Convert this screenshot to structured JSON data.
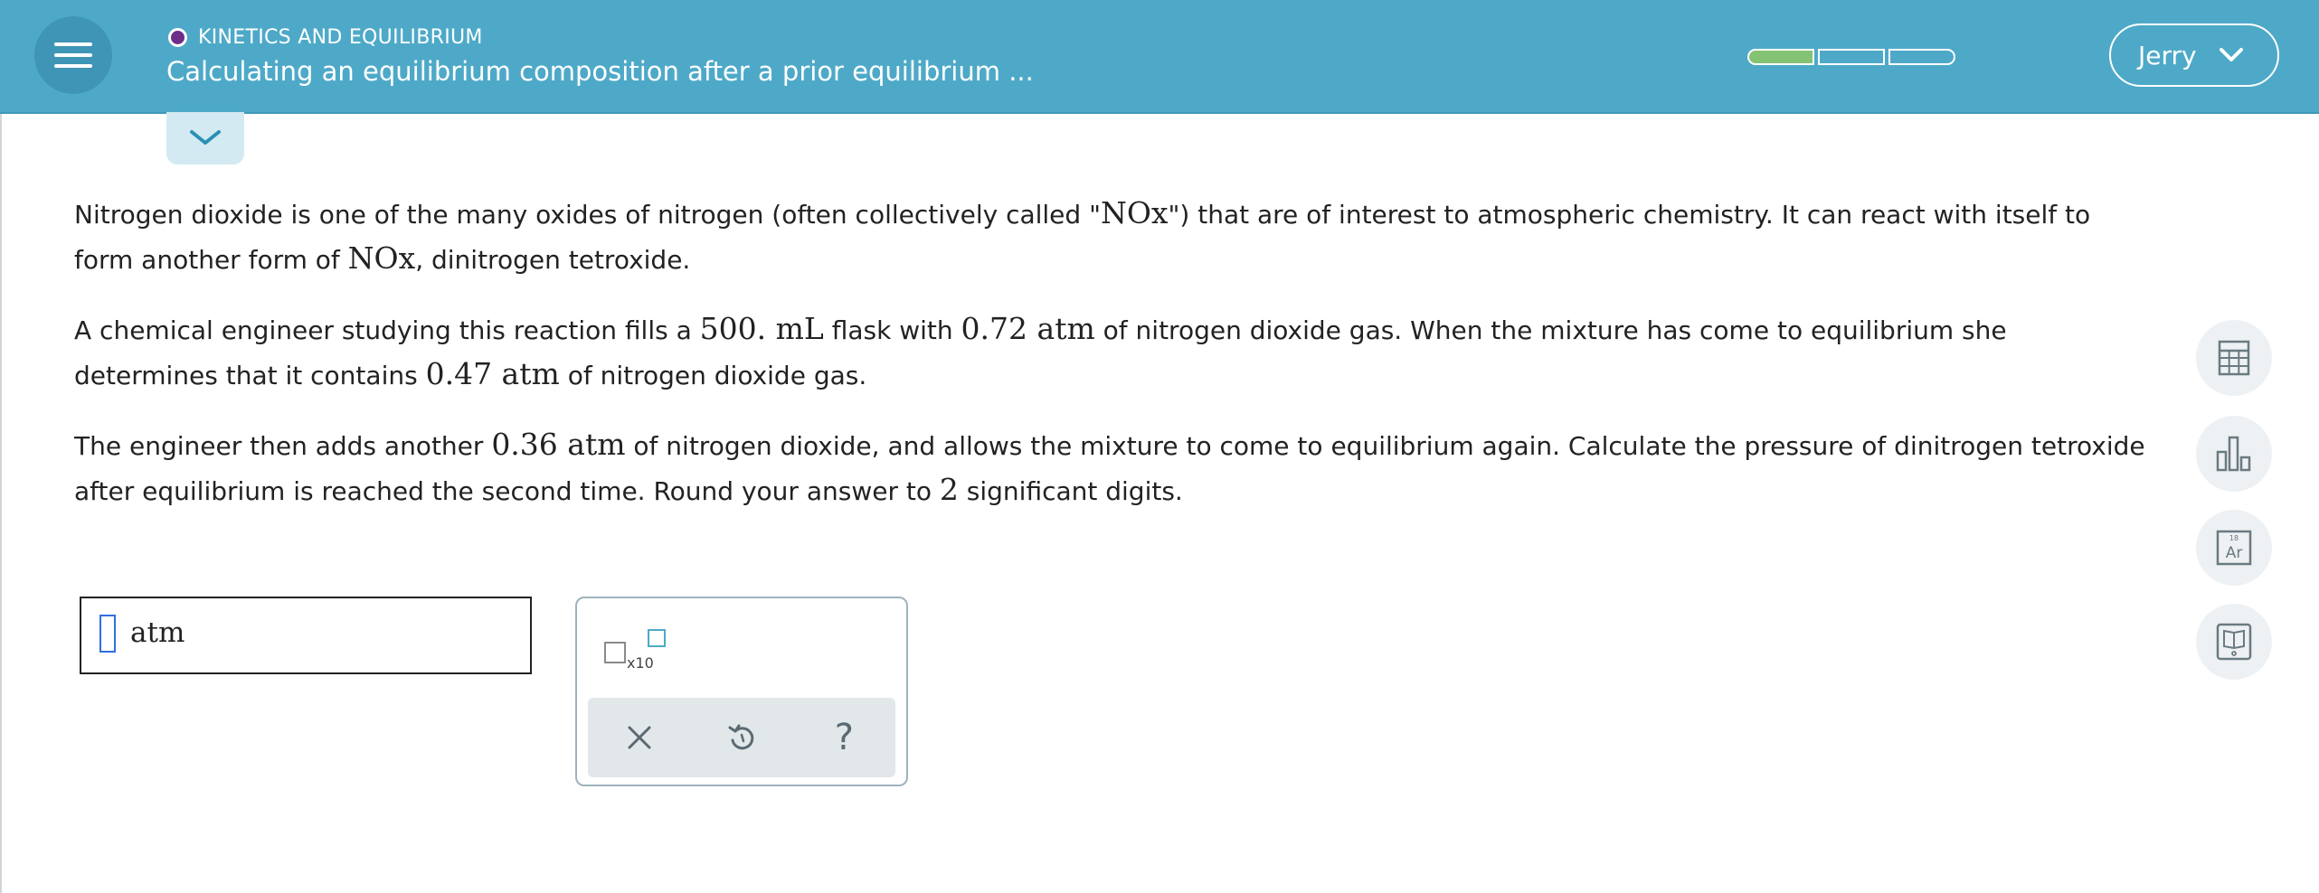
{
  "header": {
    "topic": "KINETICS AND EQUILIBRIUM",
    "title": "Calculating an equilibrium composition after a prior equilibrium ...",
    "progress": {
      "filled_segments": 1,
      "total_segments": 3
    },
    "user_name": "Jerry"
  },
  "problem": {
    "p1": {
      "t1": "Nitrogen dioxide is one of the many oxides of nitrogen (often collectively called \"",
      "m1": "NOx",
      "t2": "\") that are of interest to atmospheric chemistry. It can react with itself to form another form of ",
      "m2": "NOx",
      "t3": ", dinitrogen tetroxide."
    },
    "p2": {
      "t1": "A chemical engineer studying this reaction fills a ",
      "m1": "500. mL",
      "t2": " flask with ",
      "m2": "0.72 atm",
      "t3": " of nitrogen dioxide gas. When the mixture has come to equilibrium she determines that it contains ",
      "m3": "0.47 atm",
      "t4": " of nitrogen dioxide gas."
    },
    "p3": {
      "t1": "The engineer then adds another ",
      "m1": "0.36 atm",
      "t2": " of nitrogen dioxide, and allows the mixture to come to equilibrium again. Calculate the pressure of dinitrogen tetroxide after equilibrium is reached the second time. Round your answer to ",
      "m2": "2",
      "t3": " significant digits."
    }
  },
  "answer": {
    "value": "",
    "unit": "atm"
  },
  "keypad": {
    "sci_label": "x10",
    "help_label": "?"
  },
  "tools": [
    "calculator-icon",
    "data-chart-icon",
    "periodic-table-icon",
    "textbook-icon"
  ],
  "colors": {
    "header_bg": "#4ea9c8",
    "progress_fill": "#84c274",
    "topic_dot": "#6c2e87",
    "caret": "#2f6fe0"
  }
}
